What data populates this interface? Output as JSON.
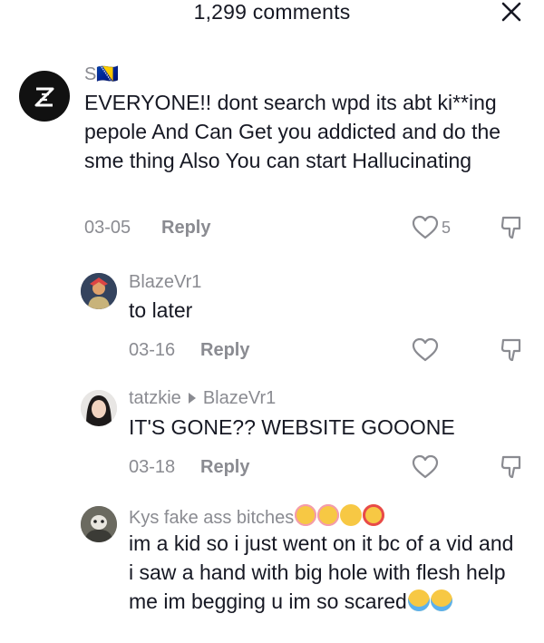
{
  "header": {
    "title": "1,299 comments"
  },
  "comments": [
    {
      "username": "S🇧🇦",
      "text": "EVERYONE!! dont search wpd its abt ki**ing pepole And Can Get you addicted and do the sme thing Also You can start Hallucinating",
      "date": "03-05",
      "reply_label": "Reply",
      "likes": "5"
    },
    {
      "username": "BlazeVr1",
      "text": "to later",
      "date": "03-16",
      "reply_label": "Reply"
    },
    {
      "username": "tatzkie",
      "reply_to": "BlazeVr1",
      "text": "IT'S GONE?? WEBSITE GOOONE",
      "date": "03-18",
      "reply_label": "Reply"
    },
    {
      "username": "Kys fake ass bitches",
      "username_emojis": [
        "smiling-face-with-hearts",
        "smiling-face-with-hearts",
        "smiling-face",
        "star-struck"
      ],
      "text": "im a kid so i just went on it bc of a vid and i saw a hand with big hole with flesh help me im begging u im so scared",
      "text_emojis": [
        "loudly-crying-face",
        "loudly-crying-face"
      ]
    }
  ],
  "colors": {
    "text": "#161823",
    "muted": "#8a8b91",
    "background": "#ffffff"
  }
}
